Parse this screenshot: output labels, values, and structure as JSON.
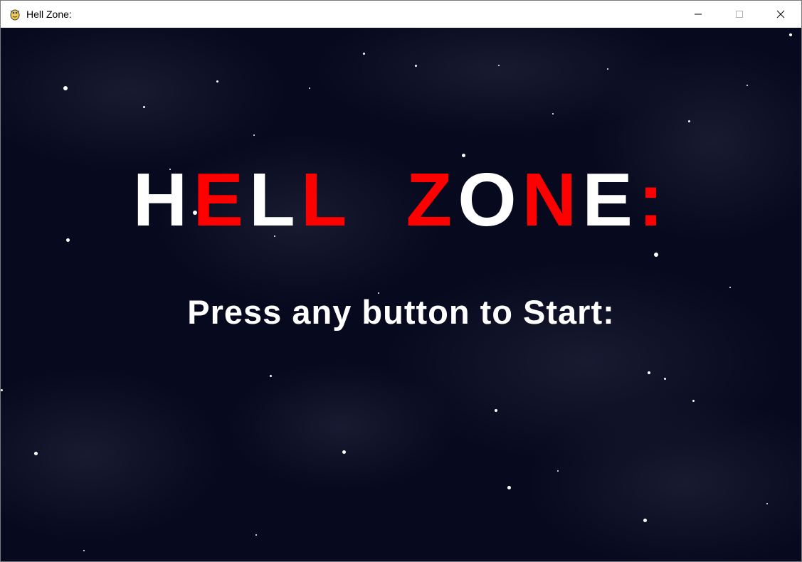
{
  "window": {
    "title": "Hell Zone:",
    "icon": "pygame-snake-icon",
    "controls": [
      "minimize-icon",
      "maximize-icon",
      "close-icon"
    ]
  },
  "game": {
    "title_letters": [
      {
        "char": "H",
        "color": "#ffffff"
      },
      {
        "char": "E",
        "color": "#ff0000"
      },
      {
        "char": "L",
        "color": "#ffffff"
      },
      {
        "char": "L",
        "color": "#ff0000"
      },
      {
        "char": " ",
        "color": "#ffffff"
      },
      {
        "char": "Z",
        "color": "#ff0000"
      },
      {
        "char": "O",
        "color": "#ffffff"
      },
      {
        "char": "N",
        "color": "#ff0000"
      },
      {
        "char": "E",
        "color": "#ffffff"
      },
      {
        "char": ":",
        "color": "#ff0000"
      }
    ],
    "prompt": "Press any button to Start:"
  },
  "colors": {
    "background": "#070a1e",
    "accent_red": "#ff0000",
    "text_white": "#ffffff"
  }
}
